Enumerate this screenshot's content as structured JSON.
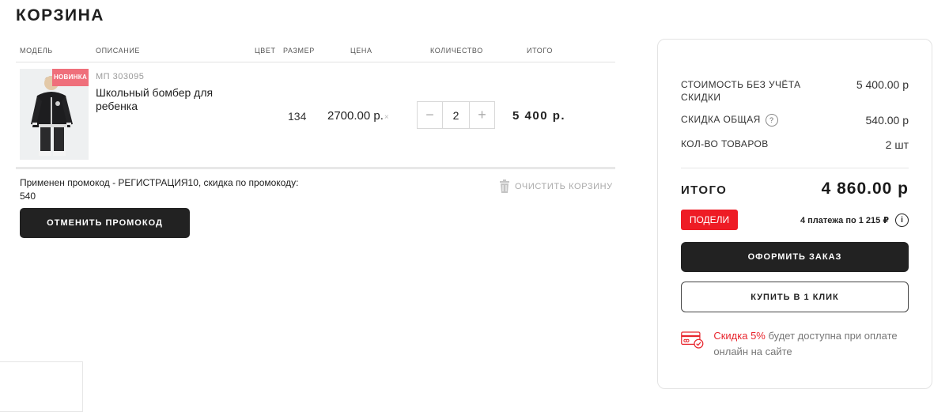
{
  "page_title": "КОРЗИНА",
  "table": {
    "headers": {
      "model": "МОДЕЛЬ",
      "description": "ОПИСАНИЕ",
      "color": "ЦВЕТ",
      "size": "РАЗМЕР",
      "price": "ЦЕНА",
      "quantity": "КОЛИЧЕСТВО",
      "total": "ИТОГО"
    },
    "items": [
      {
        "badge": "НОВИНКА",
        "sku": "МП 303095",
        "name": "Школьный бомбер для ребенка",
        "size": "134",
        "price": "2700.00 р.",
        "price_suffix": "×",
        "quantity": "2",
        "qty_minus": "−",
        "qty_plus": "+",
        "total": "5 400 р."
      }
    ]
  },
  "promo": {
    "applied_text": "Применен промокод - РЕГИСТРАЦИЯ10, скидка по промокоду: 540",
    "cancel_label": "ОТМЕНИТЬ ПРОМОКОД"
  },
  "clear_cart_label": "ОЧИСТИТЬ КОРЗИНУ",
  "summary": {
    "cost_label": "СТОИМОСТЬ БЕЗ УЧЁТА СКИДКИ",
    "cost_value": "5 400.00 р",
    "discount_label": "СКИДКА ОБЩАЯ",
    "discount_help": "?",
    "discount_value": "540.00 р",
    "count_label": "КОЛ-ВО ТОВАРОВ",
    "count_value": "2 шт",
    "total_label": "ИТОГО",
    "total_value": "4 860.00 р",
    "podeli_label": "ПОДЕЛИ",
    "installments": "4 платежа по 1 215 ₽",
    "info": "i",
    "order_button": "ОФОРМИТЬ ЗАКАЗ",
    "oneclick_button": "КУПИТЬ В 1 КЛИК",
    "discount_note_highlight": "Скидка 5%",
    "discount_note_rest": " будет доступна при оплате онлайн на сайте"
  },
  "colors": {
    "accent_red": "#e8262e",
    "podeli_red": "#ee1c25",
    "badge_pink": "#ef6f7b",
    "dark_button": "#222222"
  },
  "icons": [
    "trash-icon",
    "card-check-icon",
    "info-icon",
    "question-icon"
  ]
}
